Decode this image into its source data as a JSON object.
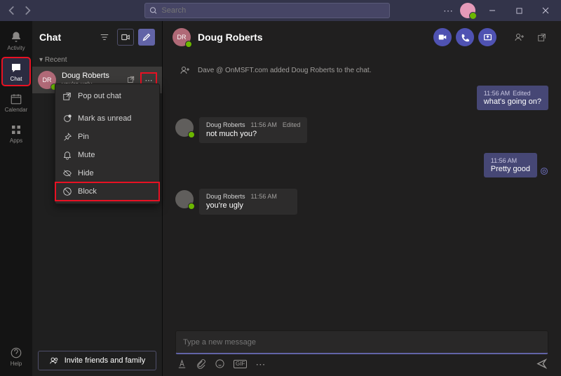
{
  "titlebar": {
    "search_placeholder": "Search"
  },
  "rail": {
    "activity": "Activity",
    "chat": "Chat",
    "calendar": "Calendar",
    "apps": "Apps",
    "help": "Help"
  },
  "chatlist": {
    "title": "Chat",
    "section_recent": "Recent",
    "items": [
      {
        "initials": "DR",
        "name": "Doug Roberts",
        "preview": "you're ugly"
      }
    ],
    "invite": "Invite friends and family"
  },
  "context_menu": {
    "pop_out": "Pop out chat",
    "mark_unread": "Mark as unread",
    "pin": "Pin",
    "mute": "Mute",
    "hide": "Hide",
    "block": "Block"
  },
  "chat": {
    "header_initials": "DR",
    "header_name": "Doug Roberts",
    "system_message": "Dave @ OnMSFT.com added Doug Roberts to the chat.",
    "messages": [
      {
        "dir": "out",
        "time": "11:56 AM",
        "edited": "Edited",
        "body": "what's going on?"
      },
      {
        "dir": "in",
        "name": "Doug Roberts",
        "time": "11:56 AM",
        "edited": "Edited",
        "body": "not much you?"
      },
      {
        "dir": "out",
        "time": "11:56 AM",
        "edited": "",
        "body": "Pretty good"
      },
      {
        "dir": "in",
        "name": "Doug Roberts",
        "time": "11:56 AM",
        "edited": "",
        "body": "you're ugly"
      }
    ],
    "compose_placeholder": "Type a new message",
    "gif_label": "GIF"
  }
}
